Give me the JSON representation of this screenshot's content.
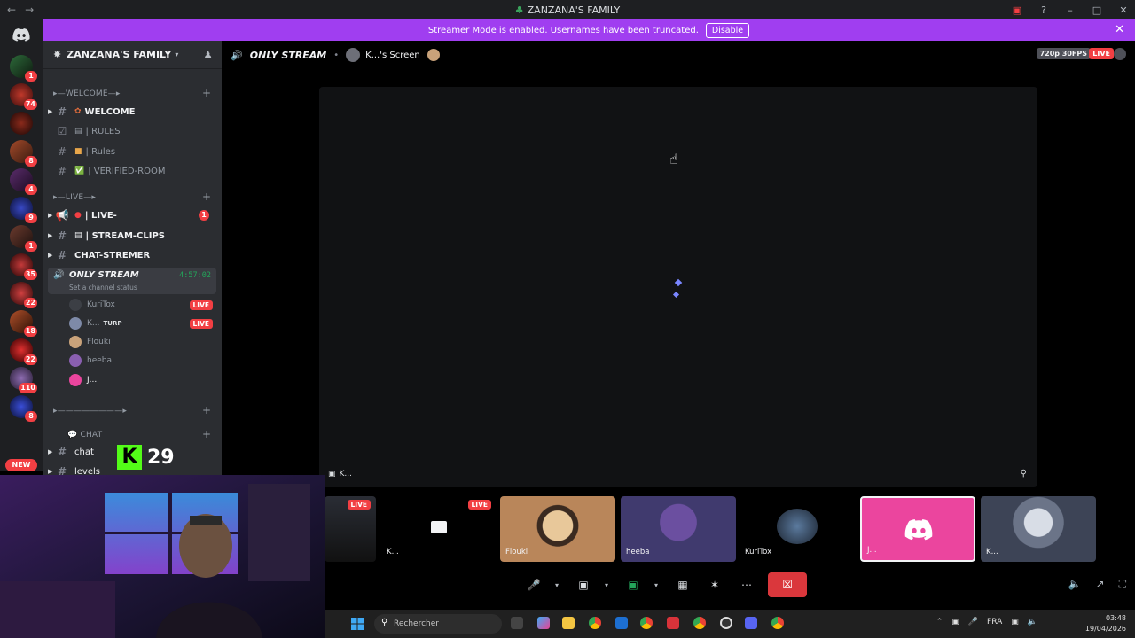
{
  "window": {
    "title": "ZANZANA'S FAMILY"
  },
  "banner": {
    "text": "Streamer Mode is enabled. Usernames have been truncated.",
    "disable_label": "Disable"
  },
  "server": {
    "name": "ZANZANA'S FAMILY"
  },
  "rail": {
    "badges": [
      "1",
      "74",
      "8",
      "4",
      "9",
      "1",
      "35",
      "22",
      "18",
      "22",
      "110",
      "8"
    ],
    "new_label": "NEW"
  },
  "categories": {
    "welcome": "▸—WELCOME—▸",
    "live": "▸—LIVE—▸",
    "misc": "▸————————▸",
    "chat": "💬 CHAT"
  },
  "channels": {
    "welcome": "WELCOME",
    "rules": "| RULES",
    "rules2": "| Rules",
    "verified": "| VERIFIED-ROOM",
    "live": "| LIVE-",
    "live_badge": "1",
    "clips": "| STREAM-CLIPS",
    "chat_streamer": "CHAT-STREMER",
    "only_stream": "ONLY STREAM",
    "only_stream_status": "Set a channel status",
    "only_stream_time": "4:57:02",
    "chat": "chat",
    "levels": "levels"
  },
  "voice_users": [
    {
      "name": "KuriTox",
      "live": "LIVE"
    },
    {
      "name": "K...",
      "extra": "TURP",
      "live": "LIVE"
    },
    {
      "name": "Flouki"
    },
    {
      "name": "heeba"
    },
    {
      "name": "J..."
    }
  ],
  "topbar": {
    "channel": "ONLY STREAM",
    "screen": "K...'s Screen",
    "quality": "720p 30FPS",
    "live": "LIVE"
  },
  "stream": {
    "label": "K..."
  },
  "thumbs": [
    {
      "name": "",
      "live": "LIVE"
    },
    {
      "name": "K...",
      "live": "LIVE"
    },
    {
      "name": "Flouki"
    },
    {
      "name": "heeba"
    },
    {
      "name": "KuriTox"
    },
    {
      "name": "J..."
    },
    {
      "name": "K..."
    }
  ],
  "kick": {
    "count": "29"
  },
  "taskbar": {
    "search": "Rechercher",
    "lang": "FRA",
    "time": "03:48",
    "date": "19/04/2026"
  },
  "colors": {
    "accent": "#a03ef0",
    "live": "#f23f43",
    "green": "#23a55a",
    "discord": "#5865f2"
  }
}
